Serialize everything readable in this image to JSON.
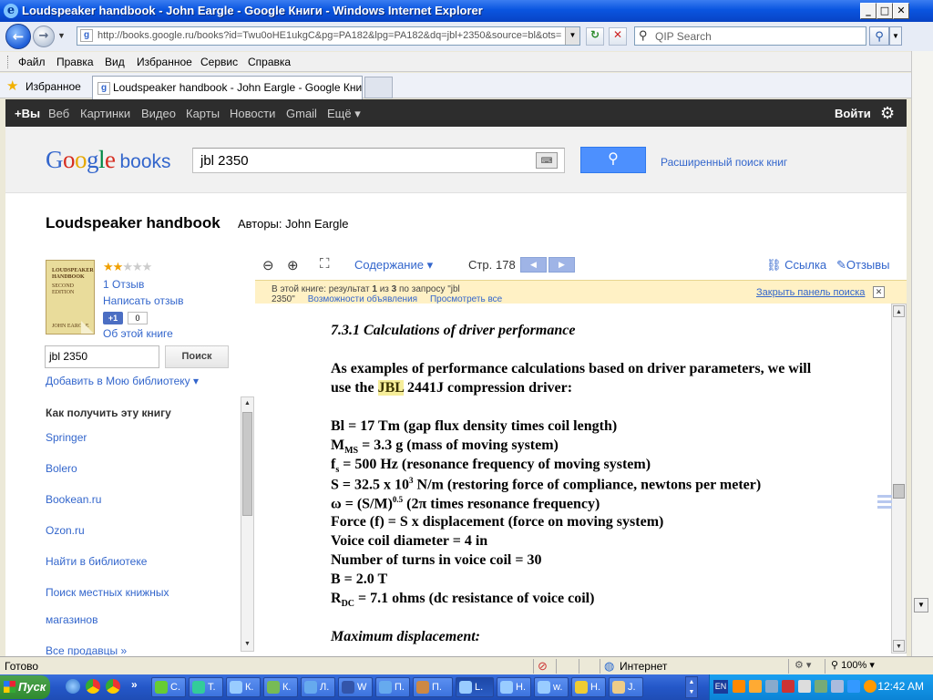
{
  "window": {
    "title": "Loudspeaker handbook - John Eargle - Google Книги - Windows Internet Explorer"
  },
  "address": {
    "url": "http://books.google.ru/books?id=Twu0oHE1ukgC&pg=PA182&lpg=PA182&dq=jbl+2350&source=bl&ots="
  },
  "qip": {
    "placeholder": "QIP Search"
  },
  "menu": [
    "Файл",
    "Правка",
    "Вид",
    "Избранное",
    "Сервис",
    "Справка"
  ],
  "favorites": {
    "label": "Избранное"
  },
  "tab": {
    "title": "Loudspeaker handbook - John Eargle - Google Книги"
  },
  "gbar": {
    "links": [
      "+Вы",
      "Веб",
      "Картинки",
      "Видео",
      "Карты",
      "Новости",
      "Gmail",
      "Ещё ▾"
    ],
    "login": "Войти"
  },
  "google": {
    "logo": [
      "G",
      "o",
      "o",
      "g",
      "l",
      "e"
    ],
    "books": "books",
    "query": "jbl 2350",
    "advanced": "Расширенный поиск книг"
  },
  "book": {
    "title": "Loudspeaker handbook",
    "authors_label": "Авторы:",
    "author": "John Eargle",
    "cover_title": "LOUDSPEAKER HANDBOOK",
    "cover_edition": "SECOND EDITION",
    "cover_author": "JOHN EARGLE",
    "rating": 2,
    "reviews": "1 Отзыв",
    "write_review": "Написать отзыв",
    "plus_one": "+1",
    "plus_count": "0",
    "about": "Об этой книге",
    "search_value": "jbl 2350",
    "search_button": "Поиск",
    "add_library": "Добавить в Мою библиотеку ▾",
    "how_to_get": "Как получить эту книгу",
    "sellers": [
      "Springer",
      "Bolero",
      "Bookean.ru",
      "Ozon.ru",
      "Найти в библиотеке",
      "Поиск местных книжных",
      "магазинов",
      "Все продавцы »"
    ]
  },
  "viewer": {
    "contents": "Содержание ▾",
    "page_label": "Стр.",
    "page_number": "178",
    "link": "Ссылка",
    "reviews": "Отзывы",
    "notice_prefix": "В этой книге: результат",
    "notice_current": "1",
    "notice_of": "из",
    "notice_total": "3",
    "notice_query": "по запросу \"jbl",
    "notice_query2": "2350\"",
    "notice_more": "Возможности объявления",
    "notice_view": "Просмотреть все",
    "close_panel": "Закрыть панель поиска"
  },
  "page": {
    "heading": "7.3.1 Calculations of driver performance",
    "intro1": "As examples of performance calculations based on driver parameters, we will",
    "intro2_pre": "use the ",
    "intro2_hl": "JBL",
    "intro2_post": " 2441J compression driver:",
    "params": [
      {
        "pre": "Bl = 17 Tm (gap flux density times coil length)"
      },
      {
        "pre": "M",
        "sub": "MS",
        "post": " = 3.3 g (mass of moving system)"
      },
      {
        "pre": "f",
        "sub": "s",
        "post": " = 500 Hz (resonance frequency of moving system)"
      },
      {
        "pre": "S = 32.5 x 10",
        "sup": "3",
        "post": " N/m (restoring force of compliance, newtons per meter)"
      },
      {
        "pre": "ω = (S/M)",
        "sup": "0.5",
        "post": " (2π times resonance frequency)"
      },
      {
        "pre": "Force (f) = S x displacement (force on moving system)"
      },
      {
        "pre": "Voice coil diameter  = 4 in"
      },
      {
        "pre": "Number of turns in voice coil = 30"
      },
      {
        "pre": "B = 2.0 T"
      },
      {
        "pre": "R",
        "sub": "DC",
        "post": " = 7.1 ohms (dc resistance of voice coil)"
      }
    ],
    "max_disp": "Maximum displacement:"
  },
  "status": {
    "text": "Готово",
    "zone": "Интернет",
    "zoom": "100%"
  },
  "taskbar": {
    "start": "Пуск",
    "items": [
      "С.",
      "Т.",
      "К.",
      "К.",
      "Л.",
      "W",
      "П.",
      "П.",
      "L.",
      "Н.",
      "w.",
      "Н.",
      "J."
    ],
    "clock": "12:42 AM",
    "lang": "EN"
  }
}
